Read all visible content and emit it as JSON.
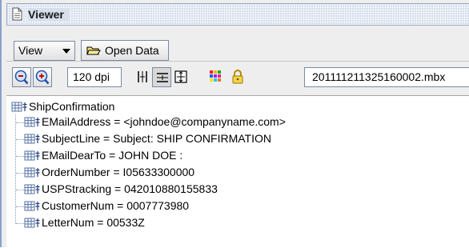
{
  "window": {
    "title": "Viewer",
    "title_icon": "document-icon"
  },
  "toolbar": {
    "view_menu_label": "View",
    "open_data_label": "Open Data",
    "dpi_value": "120 dpi",
    "file_name": "20111121132516000​2.mbx"
  },
  "tree": {
    "root": "ShipConfirmation",
    "children": [
      "EMailAddress = <johndoe@companyname.com>",
      "SubjectLine = Subject: SHIP CONFIRMATION",
      "EMailDearTo = JOHN DOE :",
      "OrderNumber = I05633300000",
      "USPStracking = 042010880155833",
      "CustomerNum = 0007773980",
      "LetterNum = 00533Z"
    ]
  },
  "colors": {
    "title_bar": "#d7dfec",
    "window_border": "#8aa0c8",
    "tree_line": "#8aa0b8"
  }
}
